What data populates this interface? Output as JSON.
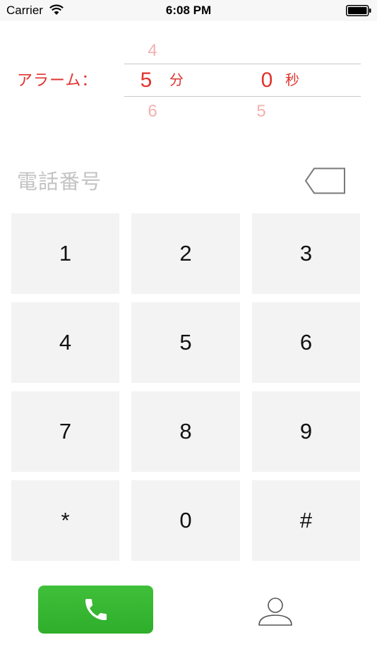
{
  "status_bar": {
    "carrier": "Carrier",
    "time": "6:08 PM",
    "icons": {
      "wifi": "wifi-icon",
      "battery": "battery-icon"
    }
  },
  "alarm": {
    "label": "アラーム：",
    "minutes": {
      "above": "4",
      "selected": "5",
      "below": "6",
      "unit": "分"
    },
    "seconds": {
      "above": "",
      "selected": "0",
      "below": "5",
      "unit": "秒"
    }
  },
  "phone_input": {
    "placeholder": "電話番号",
    "value": "",
    "backspace_icon": "backspace-icon"
  },
  "keypad": {
    "keys": [
      "1",
      "2",
      "3",
      "4",
      "5",
      "6",
      "7",
      "8",
      "9",
      "*",
      "0",
      "#"
    ]
  },
  "actions": {
    "call_icon": "phone-icon",
    "contacts_icon": "person-icon"
  },
  "colors": {
    "accent_red": "#e0332e",
    "faded_red": "#f3b1ae",
    "call_green": "#35b531",
    "key_bg": "#f3f3f3",
    "placeholder_gray": "#c3c3c3"
  }
}
